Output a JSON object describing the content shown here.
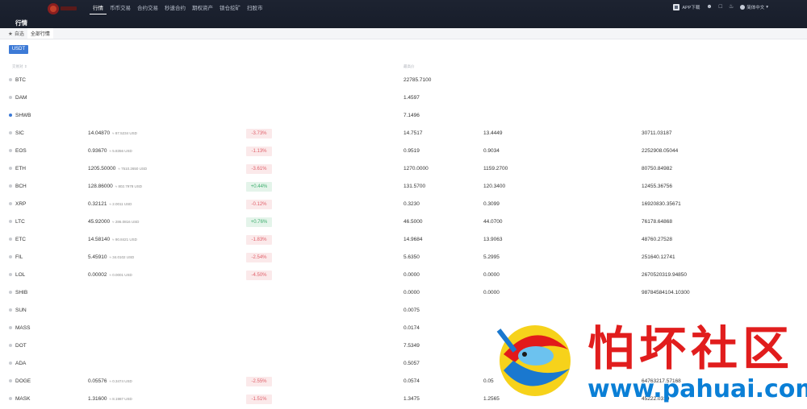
{
  "nav": {
    "items": [
      "行情",
      "币币交易",
      "合约交易",
      "秒速合约",
      "期权资产",
      "锁仓挖矿",
      "扫股市"
    ],
    "active_index": 0
  },
  "header": {
    "download": "APP下载",
    "language": "简体中文"
  },
  "page": {
    "title": "行情"
  },
  "tabs": {
    "favorites": "自选",
    "all": "全部行情"
  },
  "filter": {
    "quote": "USDT"
  },
  "columns": {
    "pair": "交易对",
    "high": "最高价"
  },
  "colors": {
    "accent": "#3d7ad6",
    "down": "#e0616b",
    "up": "#3fae6f",
    "nav_bg": "#1d2331"
  },
  "rows": [
    {
      "pair": "BTC",
      "fav": false,
      "price": "",
      "usd": "",
      "change": "",
      "dir": "",
      "high": "22785.7100",
      "low": "",
      "volume": ""
    },
    {
      "pair": "DAM",
      "fav": false,
      "price": "",
      "usd": "",
      "change": "",
      "dir": "",
      "high": "1.4597",
      "low": "",
      "volume": ""
    },
    {
      "pair": "SHWB",
      "fav": true,
      "price": "",
      "usd": "",
      "change": "",
      "dir": "",
      "high": "7.1496",
      "low": "",
      "volume": ""
    },
    {
      "pair": "SIC",
      "fav": false,
      "price": "14.04870",
      "usd": "≈ 87.5234 USD",
      "change": "-3.73%",
      "dir": "down",
      "high": "14.7517",
      "low": "13.4449",
      "volume": "30711.03187"
    },
    {
      "pair": "EOS",
      "fav": false,
      "price": "0.93670",
      "usd": "≈ 5.8356 USD",
      "change": "-1.13%",
      "dir": "down",
      "high": "0.9519",
      "low": "0.9034",
      "volume": "2252908.05044"
    },
    {
      "pair": "ETH",
      "fav": false,
      "price": "1205.50000",
      "usd": "≈ 7510.2650 USD",
      "change": "-3.61%",
      "dir": "down",
      "high": "1270.0000",
      "low": "1159.2700",
      "volume": "80750.84982"
    },
    {
      "pair": "BCH",
      "fav": false,
      "price": "128.86000",
      "usd": "≈ 802.7978 USD",
      "change": "+0.44%",
      "dir": "up",
      "high": "131.5700",
      "low": "120.3400",
      "volume": "12455.36756"
    },
    {
      "pair": "XRP",
      "fav": false,
      "price": "0.32121",
      "usd": "≈ 2.0011 USD",
      "change": "-0.12%",
      "dir": "down",
      "high": "0.3230",
      "low": "0.3099",
      "volume": "16920830.35671"
    },
    {
      "pair": "LTC",
      "fav": false,
      "price": "45.92000",
      "usd": "≈ 286.0816 USD",
      "change": "+0.76%",
      "dir": "up",
      "high": "46.5000",
      "low": "44.0700",
      "volume": "76178.64868"
    },
    {
      "pair": "ETC",
      "fav": false,
      "price": "14.58140",
      "usd": "≈ 90.8421 USD",
      "change": "-1.83%",
      "dir": "down",
      "high": "14.9684",
      "low": "13.9063",
      "volume": "48760.27528"
    },
    {
      "pair": "FIL",
      "fav": false,
      "price": "5.45910",
      "usd": "≈ 34.0102 USD",
      "change": "-2.54%",
      "dir": "down",
      "high": "5.6350",
      "low": "5.2995",
      "volume": "251640.12741"
    },
    {
      "pair": "LOL",
      "fav": false,
      "price": "0.00002",
      "usd": "≈ 0.0001 USD",
      "change": "-4.50%",
      "dir": "down",
      "high": "0.0000",
      "low": "0.0000",
      "volume": "2670520319.94850"
    },
    {
      "pair": "SHIB",
      "fav": false,
      "price": "",
      "usd": "",
      "change": "",
      "dir": "",
      "high": "0.0000",
      "low": "0.0000",
      "volume": "98784584104.10300"
    },
    {
      "pair": "SUN",
      "fav": false,
      "price": "",
      "usd": "",
      "change": "",
      "dir": "",
      "high": "0.0075",
      "low": "",
      "volume": ""
    },
    {
      "pair": "MASS",
      "fav": false,
      "price": "",
      "usd": "",
      "change": "",
      "dir": "",
      "high": "0.0174",
      "low": "",
      "volume": ""
    },
    {
      "pair": "DOT",
      "fav": false,
      "price": "",
      "usd": "",
      "change": "",
      "dir": "",
      "high": "7.5349",
      "low": "",
      "volume": ""
    },
    {
      "pair": "ADA",
      "fav": false,
      "price": "",
      "usd": "",
      "change": "",
      "dir": "",
      "high": "0.5057",
      "low": "",
      "volume": ""
    },
    {
      "pair": "DOGE",
      "fav": false,
      "price": "0.05576",
      "usd": "≈ 0.3474 USD",
      "change": "-2.55%",
      "dir": "down",
      "high": "0.0574",
      "low": "0.05",
      "volume": "64763217.57168"
    },
    {
      "pair": "MASK",
      "fav": false,
      "price": "1.31600",
      "usd": "≈ 8.1987 USD",
      "change": "-1.51%",
      "dir": "down",
      "high": "1.3475",
      "low": "1.2565",
      "volume": "45222.0310"
    }
  ],
  "watermark": {
    "text": "怕坏社区",
    "url": "www.pahuai.com"
  }
}
